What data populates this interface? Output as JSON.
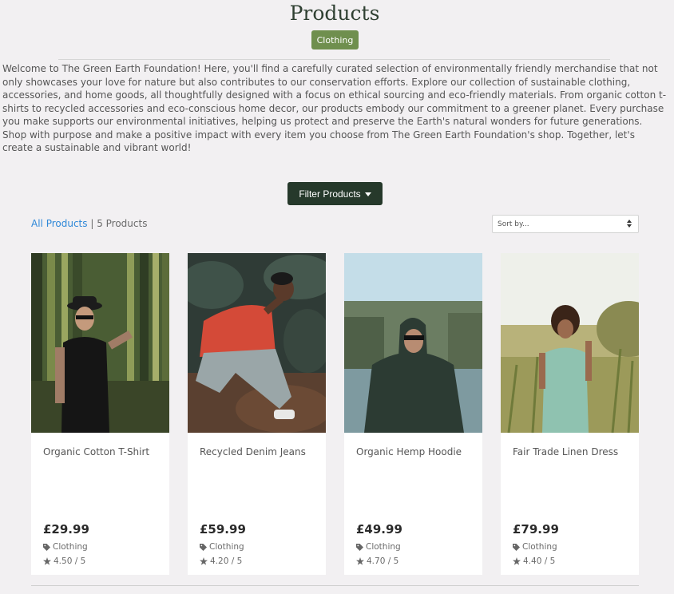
{
  "page": {
    "title": "Products",
    "category_badge": "Clothing",
    "intro": "Welcome to The Green Earth Foundation! Here, you'll find a carefully curated selection of environmentally friendly merchandise that not only showcases your love for nature but also contributes to our conservation efforts. Explore our collection of sustainable clothing, accessories, and home goods, all thoughtfully designed with a focus on ethical sourcing and eco-friendly materials. From organic cotton t-shirts to recycled accessories and eco-conscious home decor, our products embody our commitment to a greener planet. Every purchase you make supports our environmental initiatives, helping us protect and preserve the Earth's natural wonders for future generations. Shop with purpose and make a positive impact with every item you choose from The Green Earth Foundation's shop. Together, let's create a sustainable and vibrant world!"
  },
  "filter": {
    "label": "Filter Products",
    "icon": "caret-down-icon"
  },
  "listing": {
    "all_products_label": "All Products",
    "separator": " | ",
    "count_label": "5 Products",
    "sort_placeholder": "Sort by..."
  },
  "products": [
    {
      "name": "Organic Cotton T-Shirt",
      "price": "£29.99",
      "category": "Clothing",
      "rating": "4.50 / 5"
    },
    {
      "name": "Recycled Denim Jeans",
      "price": "£59.99",
      "category": "Clothing",
      "rating": "4.20 / 5"
    },
    {
      "name": "Organic Hemp Hoodie",
      "price": "£49.99",
      "category": "Clothing",
      "rating": "4.70 / 5"
    },
    {
      "name": "Fair Trade Linen Dress",
      "price": "£79.99",
      "category": "Clothing",
      "rating": "4.40 / 5"
    }
  ],
  "colors": {
    "background": "#f2f0f2",
    "badge": "#6f8f4e",
    "filter_button": "#26392b",
    "link": "#2f88d8",
    "title": "#2f4032"
  }
}
